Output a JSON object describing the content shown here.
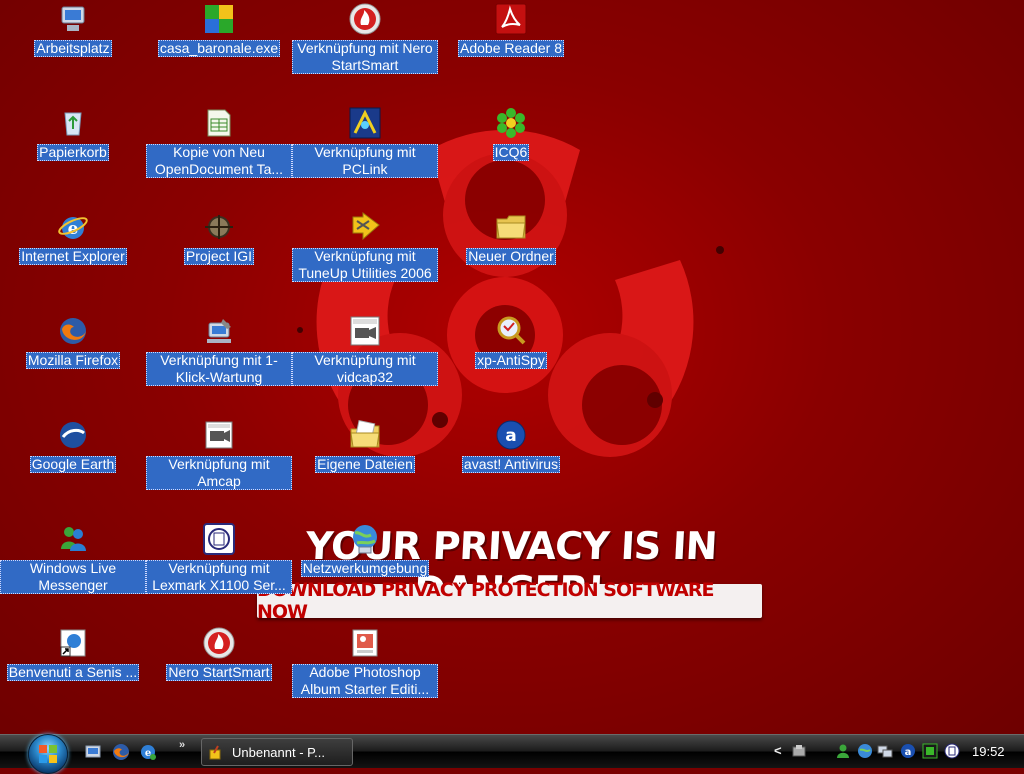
{
  "wallpaper": {
    "headline": "YOUR PRIVACY IS IN DANGER!",
    "banner": "DOWNLOAD PRIVACY PROTECTION SOFTWARE NOW"
  },
  "desktop_icons": [
    {
      "label": "Arbeitsplatz",
      "icon": "computer-icon"
    },
    {
      "label": "casa_baronale.exe",
      "icon": "puzzle-icon"
    },
    {
      "label": "Verknüpfung mit Nero StartSmart",
      "icon": "nero-icon"
    },
    {
      "label": "Adobe Reader 8",
      "icon": "adobe-reader-icon"
    },
    {
      "label": "Papierkorb",
      "icon": "recycle-bin-icon"
    },
    {
      "label": "Kopie von Neu OpenDocument Ta...",
      "icon": "spreadsheet-icon"
    },
    {
      "label": "Verknüpfung mit PCLink",
      "icon": "pclink-icon"
    },
    {
      "label": "ICQ6",
      "icon": "icq-flower-icon"
    },
    {
      "label": "Internet Explorer",
      "icon": "internet-explorer-icon"
    },
    {
      "label": "Project IGI",
      "icon": "game-icon"
    },
    {
      "label": "Verknüpfung mit TuneUp Utilities 2006",
      "icon": "tuneup-icon"
    },
    {
      "label": "Neuer Ordner",
      "icon": "folder-icon"
    },
    {
      "label": "Mozilla Firefox",
      "icon": "firefox-icon"
    },
    {
      "label": "Verknüpfung mit 1-Klick-Wartung",
      "icon": "maintenance-icon"
    },
    {
      "label": "Verknüpfung mit vidcap32",
      "icon": "vidcap-icon"
    },
    {
      "label": "xp-AntiSpy",
      "icon": "magnifier-icon"
    },
    {
      "label": "Google Earth",
      "icon": "google-earth-icon"
    },
    {
      "label": "Verknüpfung mit Amcap",
      "icon": "amcap-icon"
    },
    {
      "label": "Eigene Dateien",
      "icon": "my-documents-icon"
    },
    {
      "label": "avast! Antivirus",
      "icon": "avast-icon"
    },
    {
      "label": "Windows Live Messenger",
      "icon": "messenger-icon"
    },
    {
      "label": "Verknüpfung mit Lexmark X1100 Ser...",
      "icon": "lexmark-icon"
    },
    {
      "label": "Netzwerkumgebung",
      "icon": "network-icon"
    },
    {
      "label": "Benvenuti a Senis ...",
      "icon": "web-shortcut-icon"
    },
    {
      "label": "Nero StartSmart",
      "icon": "nero-icon"
    },
    {
      "label": "Adobe Photoshop Album Starter Editi...",
      "icon": "photoshop-album-icon"
    }
  ],
  "taskbar": {
    "task_button_label": "Unbenannt - P...",
    "quick_launch_chevron": "»",
    "tray_arrow": "<",
    "clock": "19:52"
  },
  "colors": {
    "wallpaper_red": "#8a0000",
    "selection_blue": "#316ac5"
  }
}
